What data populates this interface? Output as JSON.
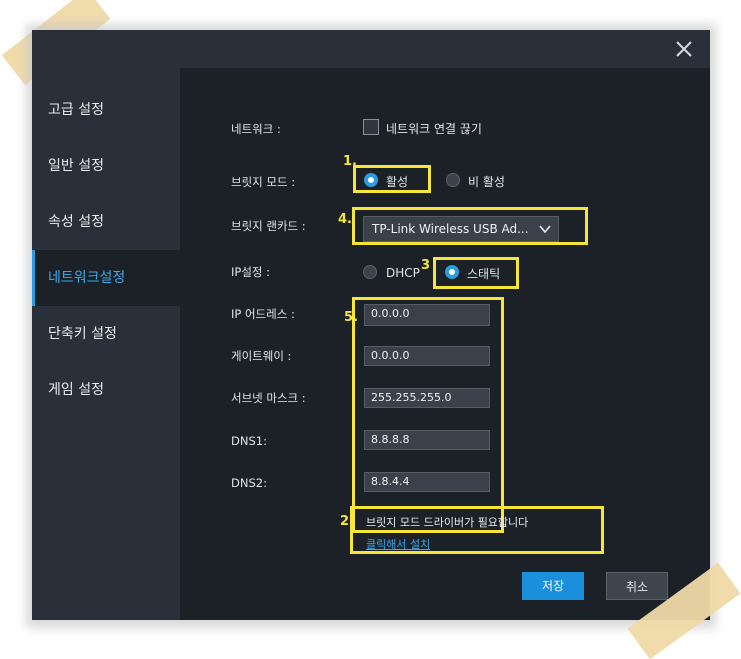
{
  "sidebar": {
    "items": [
      {
        "label": "고급 설정",
        "active": false
      },
      {
        "label": "일반 설정",
        "active": false
      },
      {
        "label": "속성 설정",
        "active": false
      },
      {
        "label": "네트워크설정",
        "active": true
      },
      {
        "label": "단축키 설정",
        "active": false
      },
      {
        "label": "게임 설정",
        "active": false
      }
    ]
  },
  "network": {
    "label": "네트워크 :",
    "disconnect_label": "네트워크 연결 끊기",
    "disconnect_checked": false
  },
  "bridge_mode": {
    "label": "브릿지 모드 :",
    "on_label": "활성",
    "off_label": "비 활성",
    "selected": "활성"
  },
  "bridge_lan": {
    "label": "브릿지 랜카드 :",
    "value": "TP-Link Wireless USB Ad..."
  },
  "ip_setting": {
    "label": "IP설정 :",
    "dhcp_label": "DHCP",
    "static_label": "스태틱",
    "selected": "스태틱"
  },
  "fields": {
    "ip_label": "IP 어드레스 :",
    "ip_value": "0.0.0.0",
    "gateway_label": "게이트웨이 :",
    "gateway_value": "0.0.0.0",
    "subnet_label": "서브넷 마스크 :",
    "subnet_value": "255.255.255.0",
    "dns1_label": "DNS1:",
    "dns1_value": "8.8.8.8",
    "dns2_label": "DNS2:",
    "dns2_value": "8.8.4.4"
  },
  "notice": {
    "text": "브릿지 모드 드라이버가 필요합니다",
    "link": "클릭해서 설치"
  },
  "buttons": {
    "save": "저장",
    "cancel": "취소"
  },
  "annotations": {
    "n1": "1.",
    "n2": "2",
    "n3": "3",
    "n4": "4.",
    "n5": "5."
  },
  "colors": {
    "accent": "#2a9ce0",
    "highlight": "#f7e63a",
    "panel": "#1c2128",
    "sidebar": "#2a3039"
  }
}
